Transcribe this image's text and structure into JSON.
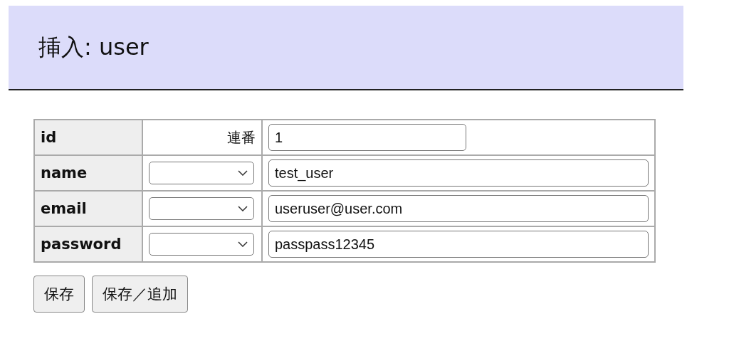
{
  "title": "挿入: user",
  "fields": [
    {
      "name": "id",
      "kind": "serial",
      "modifier": "連番",
      "value": "1"
    },
    {
      "name": "name",
      "kind": "select",
      "value": "test_user"
    },
    {
      "name": "email",
      "kind": "select",
      "value": "useruser@user.com"
    },
    {
      "name": "password",
      "kind": "select",
      "value": "passpass12345"
    }
  ],
  "buttons": [
    "保存",
    "保存／追加"
  ]
}
